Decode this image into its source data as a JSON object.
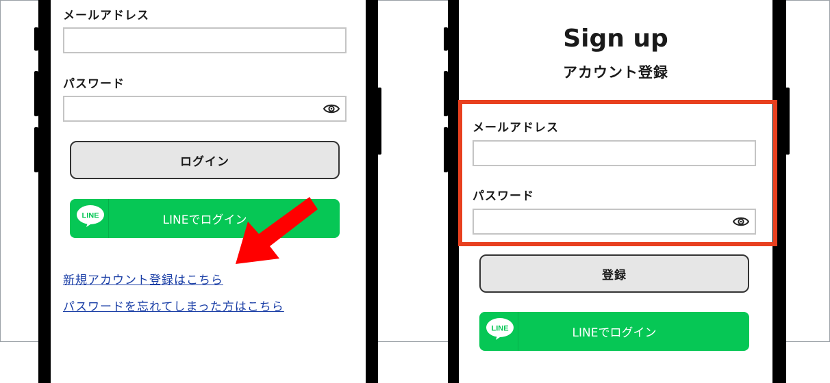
{
  "left_screen": {
    "email_label": "メールアドレス",
    "email_value": "",
    "password_label": "パスワード",
    "password_value": "",
    "login_button": "ログイン",
    "line_login_button": "LINEでログイン",
    "line_logo_text": "LINE",
    "signup_link": "新規アカウント登録はこちら",
    "forgot_password_link": "パスワードを忘れてしまった方はこちら"
  },
  "right_screen": {
    "title": "Sign up",
    "subtitle": "アカウント登録",
    "email_label": "メールアドレス",
    "email_value": "",
    "password_label": "パスワード",
    "password_value": "",
    "register_button": "登録",
    "line_login_button": "LINEでログイン",
    "line_logo_text": "LINE"
  },
  "colors": {
    "line_green": "#06c755",
    "highlight_red": "#e8401f",
    "arrow_red": "#ff0000",
    "link_blue": "#1a3ea6"
  },
  "icons": [
    "eye-icon",
    "line-logo-icon",
    "pointer-arrow"
  ]
}
